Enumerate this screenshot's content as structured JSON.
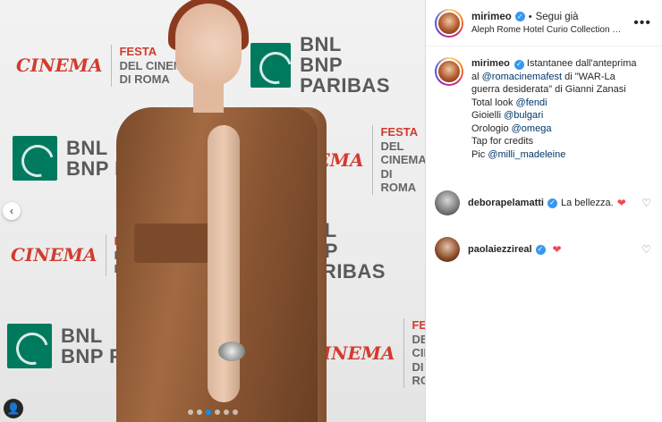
{
  "photo": {
    "sponsor_bnl_line1": "BNL",
    "sponsor_bnl_line2": "BNP PARIBAS",
    "cinema_logo": "CINEMA",
    "festa_line1": "FESTA",
    "festa_line2": "DEL CINEMA",
    "festa_line3": "DI ROMA",
    "carousel_prev_icon": "chevron-left-icon",
    "carousel_dots": 6,
    "carousel_active_index": 0,
    "tag_icon": "user-tag-icon"
  },
  "post": {
    "header": {
      "username": "mirimeo",
      "separator": "•",
      "follow_label": "Segui già",
      "location": "Aleph Rome Hotel Curio Collection by ...",
      "more_label": "•••"
    },
    "caption": {
      "username": "mirimeo",
      "line1": "Istantanee dall'anteprima",
      "line2_prefix": "al ",
      "line2_mention": "@romacinemafest",
      "line2_suffix": " di \"WAR-La",
      "line3_prefix": "guerra desiderata\" di Gianni Zanasi",
      "line4_prefix": "Total look ",
      "line4_mention": "@fendi",
      "line5_prefix": "Gioielli ",
      "line5_mention": "@bulgari",
      "line6_prefix": "Orologio ",
      "line6_mention": "@omega",
      "line7": "Tap for credits",
      "line8_prefix": "Pic ",
      "line8_mention": "@milli_madeleine"
    },
    "comments": [
      {
        "username": "deborapelamatti",
        "text": "La bellezza.",
        "emoji": "❤"
      },
      {
        "username": "paolaiezzireal",
        "text": "",
        "emoji": "❤"
      }
    ]
  }
}
